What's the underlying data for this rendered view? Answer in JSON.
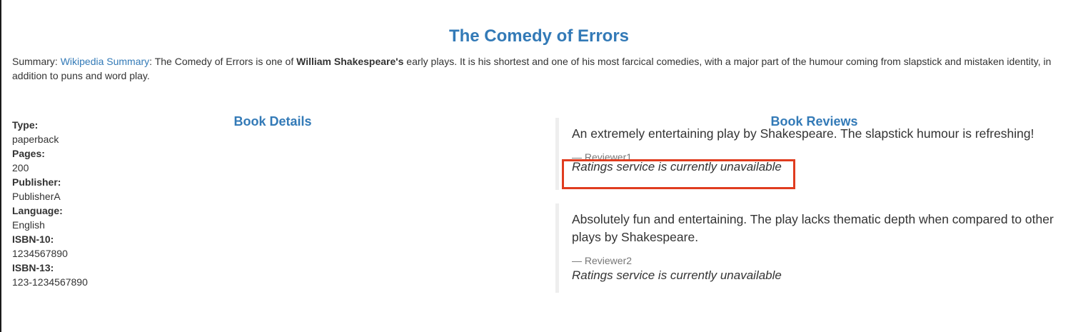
{
  "book": {
    "title": "The Comedy of Errors"
  },
  "summary": {
    "prefix": "Summary: ",
    "link_text": "Wikipedia Summary",
    "text_before_bold": ": The Comedy of Errors is one of ",
    "bold_text": "William Shakespeare's",
    "text_after_bold": " early plays. It is his shortest and one of his most farcical comedies, with a major part of the humour coming from slapstick and mistaken identity, in addition to puns and word play."
  },
  "details": {
    "heading": "Book Details",
    "fields": [
      {
        "label": "Type:",
        "value": "paperback"
      },
      {
        "label": "Pages:",
        "value": "200"
      },
      {
        "label": "Publisher:",
        "value": "PublisherA"
      },
      {
        "label": "Language:",
        "value": "English"
      },
      {
        "label": "ISBN-10:",
        "value": "1234567890"
      },
      {
        "label": "ISBN-13:",
        "value": "123-1234567890"
      }
    ]
  },
  "reviews": {
    "heading": "Book Reviews",
    "items": [
      {
        "text": "An extremely entertaining play by Shakespeare. The slapstick humour is refreshing!",
        "author": "— Reviewer1",
        "rating": "Ratings service is currently unavailable"
      },
      {
        "text": "Absolutely fun and entertaining. The play lacks thematic depth when compared to other plays by Shakespeare.",
        "author": "— Reviewer2",
        "rating": "Ratings service is currently unavailable"
      }
    ]
  },
  "colors": {
    "accent": "#337ab7",
    "highlight": "#e03c1f",
    "review_border": "#eeeeee",
    "author": "#777777"
  }
}
